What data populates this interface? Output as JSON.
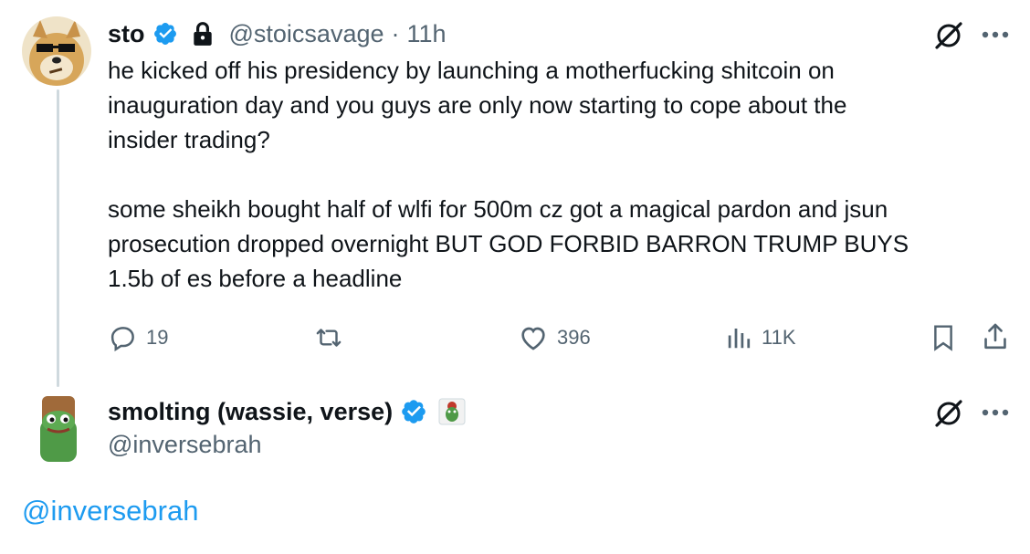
{
  "tweet": {
    "display_name": "sto",
    "handle": "@stoicsavage",
    "separator": "·",
    "time": "11h",
    "lines": [
      "he kicked off his presidency by launching a motherfucking shitcoin on",
      "inauguration day and you guys are only now starting to cope about the",
      "insider trading?",
      "some sheikh bought half of wlfi for 500m cz got a magical pardon and jsun",
      "prosecution dropped overnight BUT GOD FORBID BARRON TRUMP BUYS",
      "1.5b of es before a headline"
    ],
    "replies": "19",
    "likes": "396",
    "views": "11K"
  },
  "reply": {
    "display_name": "smolting (wassie, verse)",
    "handle": "@inversebrah"
  },
  "footer_link": "@inversebrah",
  "colors": {
    "verified": "#1d9bf0",
    "link": "#1d9bf0",
    "muted": "#536471"
  }
}
